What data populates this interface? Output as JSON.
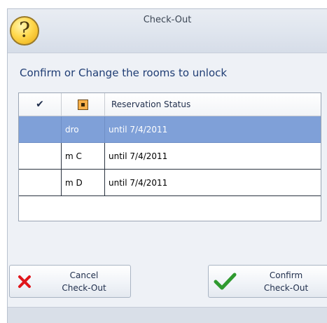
{
  "window": {
    "title": "Check-Out"
  },
  "heading": "Confirm or Change the rooms to unlock",
  "grid": {
    "columns": {
      "col3": "Reservation Status"
    },
    "rows": [
      {
        "room": "dro",
        "status": "until 7/4/2011"
      },
      {
        "room": "m C",
        "status": "until 7/4/2011"
      },
      {
        "room": "m D",
        "status": "until 7/4/2011"
      }
    ]
  },
  "buttons": {
    "cancel": {
      "line1": "Cancel",
      "line2": "Check-Out"
    },
    "confirm": {
      "line1": "Confirm",
      "line2": "Check-Out"
    }
  },
  "icons": {
    "title": "question-icon",
    "col1": "checkmark-icon",
    "col2": "room-key-icon",
    "cancel": "cross-icon",
    "confirm": "checkmark-icon"
  },
  "colors": {
    "selected_row": "#7fa0d8",
    "heading": "#1f3d74",
    "cancel_icon": "#e0161b",
    "confirm_icon": "#2f9a2f"
  }
}
